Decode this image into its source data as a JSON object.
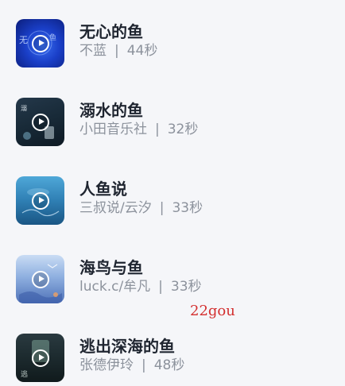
{
  "colors": {
    "background": "#f5f6f9",
    "title": "#1f2530",
    "meta": "#8c929c",
    "watermark": "#d32f2f"
  },
  "items": [
    {
      "title": "无心的鱼",
      "artist": "不蓝",
      "duration": "44秒",
      "thumb_icon": "play-icon"
    },
    {
      "title": "溺水的鱼",
      "artist": "小田音乐社",
      "duration": "32秒",
      "thumb_icon": "play-icon"
    },
    {
      "title": "人鱼说",
      "artist": "三叔说/云汐",
      "duration": "33秒",
      "thumb_icon": "play-icon"
    },
    {
      "title": "海鸟与鱼",
      "artist": "luck.c/牟凡",
      "duration": "33秒",
      "thumb_icon": "play-icon"
    },
    {
      "title": "逃出深海的鱼",
      "artist": "张德伊玲",
      "duration": "48秒",
      "thumb_icon": "play-icon"
    }
  ],
  "separator": "|",
  "watermark": "22gou"
}
